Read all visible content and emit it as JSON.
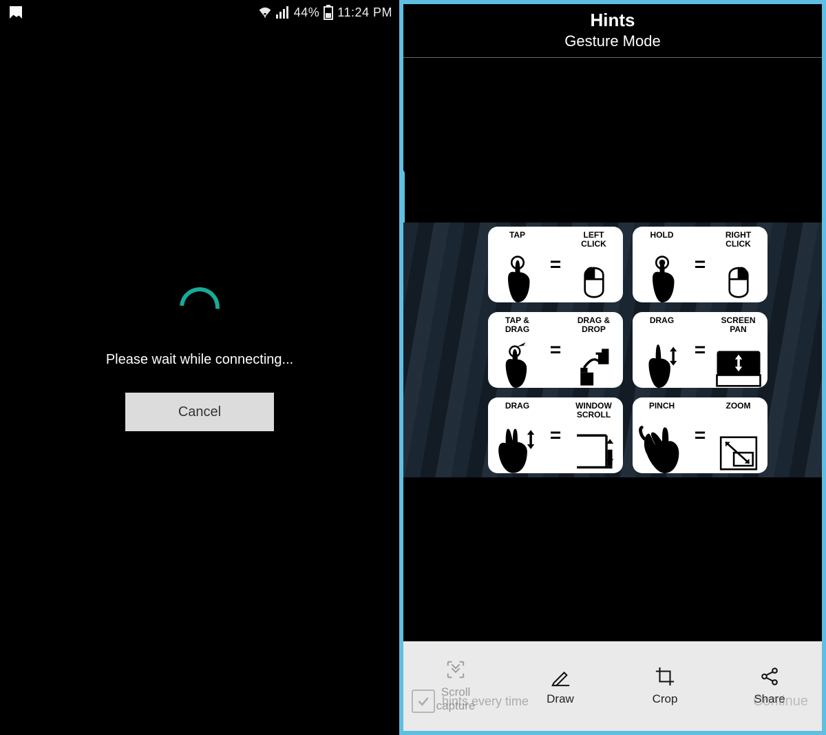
{
  "left": {
    "statusbar": {
      "battery_pct": "44%",
      "time": "11:24 PM"
    },
    "spinner_color": "#18a999",
    "wait_text": "Please wait while connecting...",
    "cancel_label": "Cancel"
  },
  "right": {
    "accent_border": "#5fbfe2",
    "header": {
      "title": "Hints",
      "subtitle": "Gesture Mode"
    },
    "cards": [
      {
        "left_label": "TAP",
        "right_label": "LEFT\nCLICK"
      },
      {
        "left_label": "HOLD",
        "right_label": "RIGHT\nCLICK"
      },
      {
        "left_label": "TAP &\nDRAG",
        "right_label": "DRAG  &\nDROP"
      },
      {
        "left_label": "DRAG",
        "right_label": "SCREEN\nPAN"
      },
      {
        "left_label": "DRAG",
        "right_label": "WINDOW\nSCROLL"
      },
      {
        "left_label": "PINCH",
        "right_label": "ZOOM"
      }
    ],
    "bottom_bar": {
      "items": [
        {
          "label": "Scroll\ncapture",
          "dim": true
        },
        {
          "label": "Draw",
          "dim": false
        },
        {
          "label": "Crop",
          "dim": false
        },
        {
          "label": "Share",
          "dim": false
        }
      ]
    },
    "overlay": {
      "checkbox_hint": "hints every time",
      "continue_label": "Continue"
    }
  }
}
